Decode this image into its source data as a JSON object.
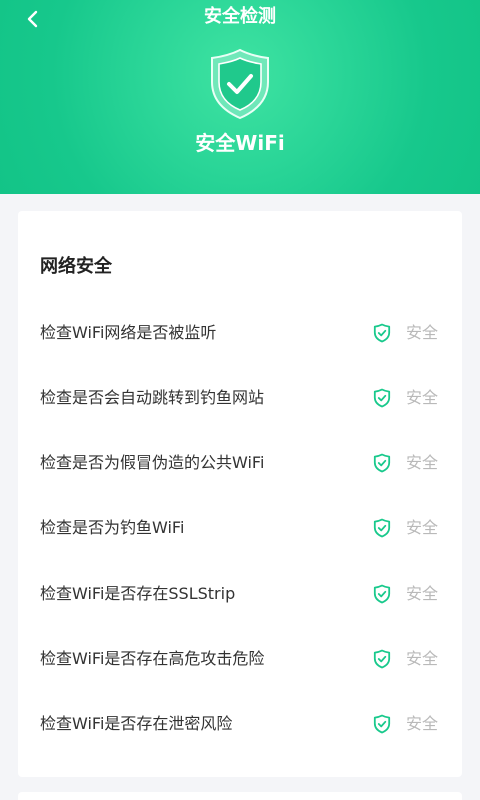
{
  "header": {
    "title": "安全检测",
    "hero_label": "安全WiFi"
  },
  "colors": {
    "accent": "#19c98c",
    "status_text": "#b9b9b9"
  },
  "icons": {
    "back": "chevron-left-icon",
    "hero": "shield-check-icon",
    "row": "shield-check-icon"
  },
  "section": {
    "title": "网络安全",
    "items": [
      {
        "label": "检查WiFi网络是否被监听",
        "status": "安全"
      },
      {
        "label": "检查是否会自动跳转到钓鱼网站",
        "status": "安全"
      },
      {
        "label": "检查是否为假冒伪造的公共WiFi",
        "status": "安全"
      },
      {
        "label": "检查是否为钓鱼WiFi",
        "status": "安全"
      },
      {
        "label": "检查WiFi是否存在SSLStrip",
        "status": "安全"
      },
      {
        "label": "检查WiFi是否存在高危攻击危险",
        "status": "安全"
      },
      {
        "label": "检查WiFi是否存在泄密风险",
        "status": "安全"
      }
    ]
  }
}
